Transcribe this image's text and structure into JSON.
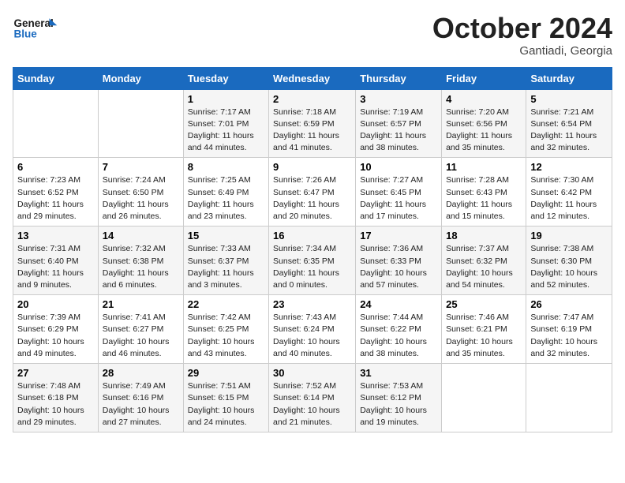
{
  "header": {
    "logo_line1": "General",
    "logo_line2": "Blue",
    "month": "October 2024",
    "location": "Gantiadi, Georgia"
  },
  "days_of_week": [
    "Sunday",
    "Monday",
    "Tuesday",
    "Wednesday",
    "Thursday",
    "Friday",
    "Saturday"
  ],
  "weeks": [
    [
      {
        "day": "",
        "info": ""
      },
      {
        "day": "",
        "info": ""
      },
      {
        "day": "1",
        "info": "Sunrise: 7:17 AM\nSunset: 7:01 PM\nDaylight: 11 hours and 44 minutes."
      },
      {
        "day": "2",
        "info": "Sunrise: 7:18 AM\nSunset: 6:59 PM\nDaylight: 11 hours and 41 minutes."
      },
      {
        "day": "3",
        "info": "Sunrise: 7:19 AM\nSunset: 6:57 PM\nDaylight: 11 hours and 38 minutes."
      },
      {
        "day": "4",
        "info": "Sunrise: 7:20 AM\nSunset: 6:56 PM\nDaylight: 11 hours and 35 minutes."
      },
      {
        "day": "5",
        "info": "Sunrise: 7:21 AM\nSunset: 6:54 PM\nDaylight: 11 hours and 32 minutes."
      }
    ],
    [
      {
        "day": "6",
        "info": "Sunrise: 7:23 AM\nSunset: 6:52 PM\nDaylight: 11 hours and 29 minutes."
      },
      {
        "day": "7",
        "info": "Sunrise: 7:24 AM\nSunset: 6:50 PM\nDaylight: 11 hours and 26 minutes."
      },
      {
        "day": "8",
        "info": "Sunrise: 7:25 AM\nSunset: 6:49 PM\nDaylight: 11 hours and 23 minutes."
      },
      {
        "day": "9",
        "info": "Sunrise: 7:26 AM\nSunset: 6:47 PM\nDaylight: 11 hours and 20 minutes."
      },
      {
        "day": "10",
        "info": "Sunrise: 7:27 AM\nSunset: 6:45 PM\nDaylight: 11 hours and 17 minutes."
      },
      {
        "day": "11",
        "info": "Sunrise: 7:28 AM\nSunset: 6:43 PM\nDaylight: 11 hours and 15 minutes."
      },
      {
        "day": "12",
        "info": "Sunrise: 7:30 AM\nSunset: 6:42 PM\nDaylight: 11 hours and 12 minutes."
      }
    ],
    [
      {
        "day": "13",
        "info": "Sunrise: 7:31 AM\nSunset: 6:40 PM\nDaylight: 11 hours and 9 minutes."
      },
      {
        "day": "14",
        "info": "Sunrise: 7:32 AM\nSunset: 6:38 PM\nDaylight: 11 hours and 6 minutes."
      },
      {
        "day": "15",
        "info": "Sunrise: 7:33 AM\nSunset: 6:37 PM\nDaylight: 11 hours and 3 minutes."
      },
      {
        "day": "16",
        "info": "Sunrise: 7:34 AM\nSunset: 6:35 PM\nDaylight: 11 hours and 0 minutes."
      },
      {
        "day": "17",
        "info": "Sunrise: 7:36 AM\nSunset: 6:33 PM\nDaylight: 10 hours and 57 minutes."
      },
      {
        "day": "18",
        "info": "Sunrise: 7:37 AM\nSunset: 6:32 PM\nDaylight: 10 hours and 54 minutes."
      },
      {
        "day": "19",
        "info": "Sunrise: 7:38 AM\nSunset: 6:30 PM\nDaylight: 10 hours and 52 minutes."
      }
    ],
    [
      {
        "day": "20",
        "info": "Sunrise: 7:39 AM\nSunset: 6:29 PM\nDaylight: 10 hours and 49 minutes."
      },
      {
        "day": "21",
        "info": "Sunrise: 7:41 AM\nSunset: 6:27 PM\nDaylight: 10 hours and 46 minutes."
      },
      {
        "day": "22",
        "info": "Sunrise: 7:42 AM\nSunset: 6:25 PM\nDaylight: 10 hours and 43 minutes."
      },
      {
        "day": "23",
        "info": "Sunrise: 7:43 AM\nSunset: 6:24 PM\nDaylight: 10 hours and 40 minutes."
      },
      {
        "day": "24",
        "info": "Sunrise: 7:44 AM\nSunset: 6:22 PM\nDaylight: 10 hours and 38 minutes."
      },
      {
        "day": "25",
        "info": "Sunrise: 7:46 AM\nSunset: 6:21 PM\nDaylight: 10 hours and 35 minutes."
      },
      {
        "day": "26",
        "info": "Sunrise: 7:47 AM\nSunset: 6:19 PM\nDaylight: 10 hours and 32 minutes."
      }
    ],
    [
      {
        "day": "27",
        "info": "Sunrise: 7:48 AM\nSunset: 6:18 PM\nDaylight: 10 hours and 29 minutes."
      },
      {
        "day": "28",
        "info": "Sunrise: 7:49 AM\nSunset: 6:16 PM\nDaylight: 10 hours and 27 minutes."
      },
      {
        "day": "29",
        "info": "Sunrise: 7:51 AM\nSunset: 6:15 PM\nDaylight: 10 hours and 24 minutes."
      },
      {
        "day": "30",
        "info": "Sunrise: 7:52 AM\nSunset: 6:14 PM\nDaylight: 10 hours and 21 minutes."
      },
      {
        "day": "31",
        "info": "Sunrise: 7:53 AM\nSunset: 6:12 PM\nDaylight: 10 hours and 19 minutes."
      },
      {
        "day": "",
        "info": ""
      },
      {
        "day": "",
        "info": ""
      }
    ]
  ]
}
